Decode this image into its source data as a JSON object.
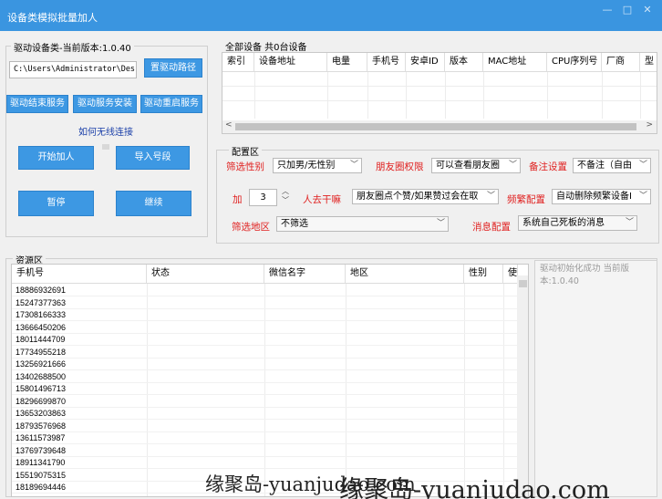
{
  "window": {
    "title": "设备类模拟批量加人",
    "controls": [
      "—",
      "□",
      "✕"
    ]
  },
  "driver": {
    "group_label": "驱动设备类-当前版本:1.0.40",
    "path_value": "C:\\Users\\Administrator\\Des",
    "set_path_button": "置驱动路径",
    "end_service_button": "驱动结束服务",
    "install_service_button": "驱动服务安装",
    "restart_service_button": "驱动重启服务",
    "wireless_link": "如何无线连接",
    "start_button": "开始加人",
    "import_button": "导入号段",
    "pause_button": "暂停",
    "continue_button": "继续"
  },
  "devices": {
    "group_label": "全部设备 共0台设备",
    "columns": [
      "索引",
      "设备地址",
      "电量",
      "手机号",
      "安卓ID",
      "版本",
      "MAC地址",
      "CPU序列号",
      "厂商",
      "型"
    ]
  },
  "config": {
    "group_label": "配置区",
    "gender_label": "筛选性别",
    "gender_value": "只加男/无性别",
    "moments_label": "朋友圈权限",
    "moments_value": "可以查看朋友圈",
    "remark_label": "备注设置",
    "remark_value": "不备注（自由",
    "add_label": "加",
    "add_value": "3",
    "disturb_label": "人去干嘛",
    "disturb_value": "朋友圈点个赞/如果赞过会在取",
    "frequent_label": "频繁配置",
    "frequent_value": "自动删除频繁设备I",
    "region_label": "筛选地区",
    "region_value": "不筛选",
    "message_label": "消息配置",
    "message_value": "系统自己死板的消息"
  },
  "resources": {
    "group_label": "资源区",
    "columns": [
      "手机号",
      "状态",
      "微信名字",
      "地区",
      "性别",
      "使"
    ],
    "phones": [
      "18886932691",
      "15247377363",
      "17308166333",
      "13666450206",
      "18011444709",
      "17734955218",
      "13256921666",
      "13402688500",
      "15801496713",
      "18296699870",
      "13653203863",
      "18793576968",
      "13611573987",
      "13769739648",
      "18911341790",
      "15519075315",
      "18189694446"
    ]
  },
  "log": {
    "text": "驱动初始化成功 当前版本:1.0.40"
  },
  "watermark": {
    "text1": "缘聚岛-yuanjudao.com",
    "text2": "缘聚岛-yuanjudao.com"
  }
}
